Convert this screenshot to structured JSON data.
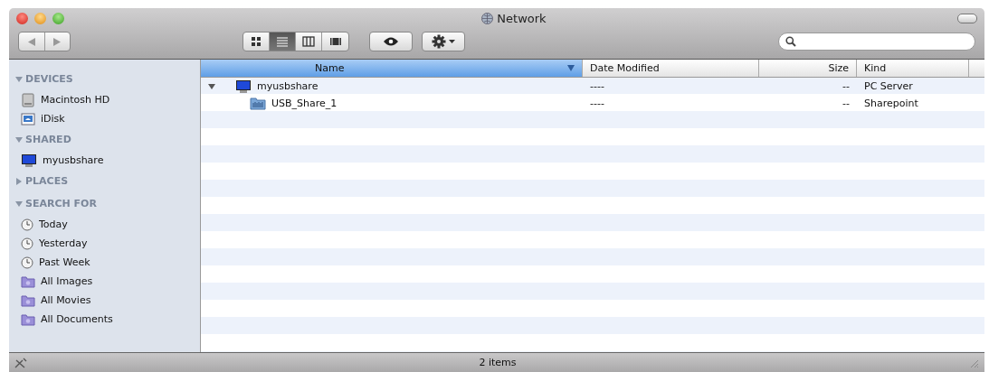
{
  "window": {
    "title": "Network"
  },
  "toolbar": {
    "view_buttons": [
      {
        "kind": "icons",
        "selected": false
      },
      {
        "kind": "list",
        "selected": true
      },
      {
        "kind": "columns",
        "selected": false
      },
      {
        "kind": "coverflow",
        "selected": false
      }
    ]
  },
  "sidebar": {
    "sections": [
      {
        "title": "DEVICES",
        "expanded": true,
        "items": [
          {
            "label": "Macintosh HD",
            "kind": "disk"
          },
          {
            "label": "iDisk",
            "kind": "idisk"
          }
        ]
      },
      {
        "title": "SHARED",
        "expanded": true,
        "items": [
          {
            "label": "myusbshare",
            "kind": "computer"
          }
        ]
      },
      {
        "title": "PLACES",
        "expanded": false
      },
      {
        "title": "SEARCH FOR",
        "expanded": true,
        "items": [
          {
            "label": "Today",
            "kind": "clock"
          },
          {
            "label": "Yesterday",
            "kind": "clock"
          },
          {
            "label": "Past Week",
            "kind": "clock"
          },
          {
            "label": "All Images",
            "kind": "smart-folder"
          },
          {
            "label": "All Movies",
            "kind": "smart-folder"
          },
          {
            "label": "All Documents",
            "kind": "smart-folder"
          }
        ]
      }
    ]
  },
  "table": {
    "columns": [
      {
        "label": "Name",
        "selected": true
      },
      {
        "label": "Date Modified",
        "selected": false
      },
      {
        "label": "Size",
        "selected": false
      },
      {
        "label": "Kind",
        "selected": false
      }
    ],
    "rows": [
      {
        "name": "myusbshare",
        "kind": "computer",
        "expanded": true,
        "date_modified": "----",
        "size": "--",
        "type": "PC Server",
        "children": [
          {
            "name": "USB_Share_1",
            "kind": "folder",
            "date_modified": "----",
            "size": "--",
            "type": "Sharepoint"
          }
        ]
      }
    ]
  },
  "status_bar": {
    "text": "2 items"
  }
}
